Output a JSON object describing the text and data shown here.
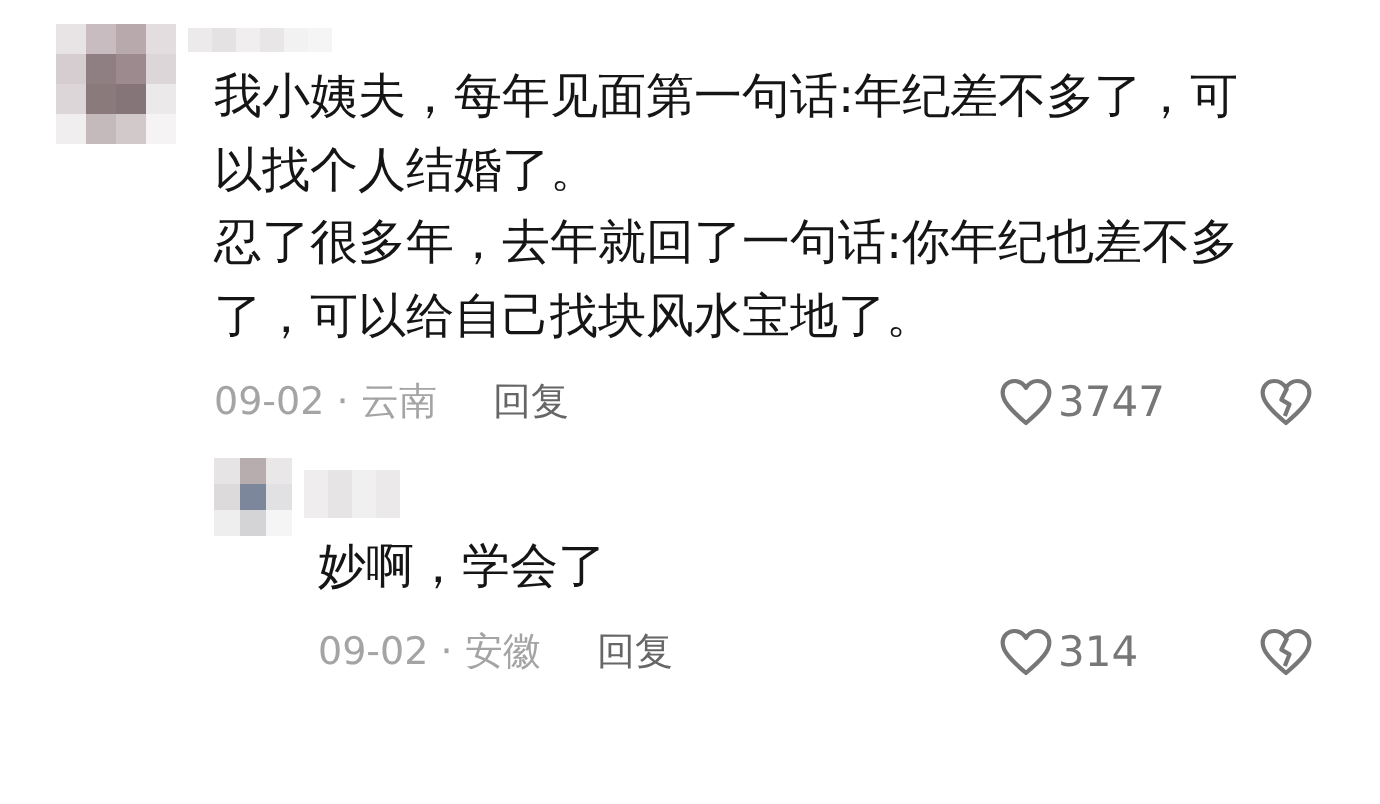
{
  "comments": [
    {
      "paragraphs": [
        "我小姨夫，每年见面第一句话:年纪差不多了，可以找个人结婚了。",
        "忍了很多年，去年就回了一句话:你年纪也差不多了，可以给自己找块风水宝地了。"
      ],
      "date": "09-02",
      "separator": "·",
      "location": "云南",
      "reply_label": "回复",
      "likes": "3747",
      "replies": [
        {
          "paragraphs": [
            "妙啊，学会了"
          ],
          "date": "09-02",
          "separator": "·",
          "location": "安徽",
          "reply_label": "回复",
          "likes": "314"
        }
      ]
    }
  ]
}
